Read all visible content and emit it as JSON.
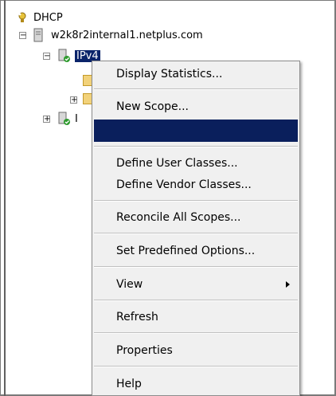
{
  "tree": {
    "root": {
      "label": "DHCP",
      "icon": "dhcp-icon"
    },
    "server": {
      "label": "w2k8r2internal1.netplus.com",
      "icon": "server-icon"
    },
    "ipv4": {
      "label": "IPv4",
      "icon": "ipv4-server-icon"
    },
    "ipv6_partial": {
      "label": "I"
    }
  },
  "menu": {
    "items": [
      {
        "label": "Display Statistics..."
      },
      {
        "label": "New Scope..."
      },
      {
        "label": ""
      },
      {
        "label": "Define User Classes..."
      },
      {
        "label": "Define Vendor Classes..."
      },
      {
        "label": "Reconcile All Scopes..."
      },
      {
        "label": "Set Predefined Options..."
      },
      {
        "label": "View"
      },
      {
        "label": "Refresh"
      },
      {
        "label": "Properties"
      },
      {
        "label": "Help"
      }
    ]
  },
  "colors": {
    "selection": "#0a246a",
    "menu_highlight": "#0a1f5c",
    "menu_bg": "#f0f0f0"
  }
}
